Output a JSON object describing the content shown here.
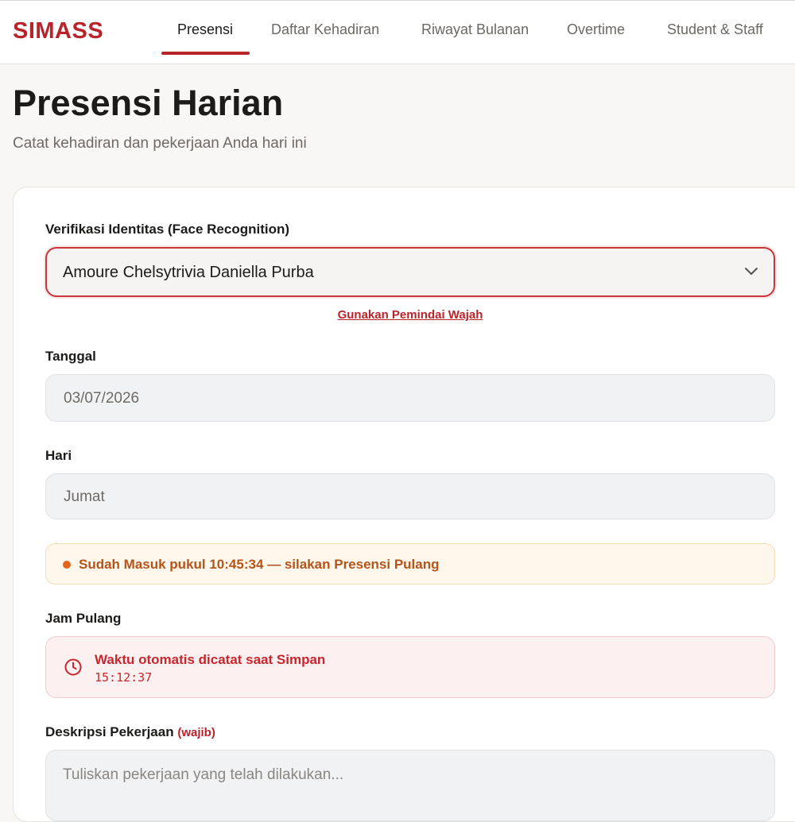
{
  "app": {
    "brand": "SIMASS"
  },
  "nav": {
    "tabs": [
      {
        "label": "Presensi",
        "active": true
      },
      {
        "label": "Daftar Kehadiran",
        "active": false
      },
      {
        "label": "Riwayat Bulanan",
        "active": false
      },
      {
        "label": "Overtime",
        "active": false
      },
      {
        "label": "Student & Staff",
        "active": false
      }
    ]
  },
  "page": {
    "title": "Presensi Harian",
    "subtitle": "Catat kehadiran dan pekerjaan Anda hari ini"
  },
  "form": {
    "identity": {
      "label": "Verifikasi Identitas (Face Recognition)",
      "selected": "Amoure Chelsytrivia Daniella Purba",
      "face_link": "Gunakan Pemindai Wajah"
    },
    "date": {
      "label": "Tanggal",
      "value": "03/07/2026"
    },
    "day": {
      "label": "Hari",
      "value": "Jumat"
    },
    "status": {
      "text": "Sudah Masuk pukul 10:45:34 — silakan Presensi Pulang"
    },
    "checkout": {
      "label": "Jam Pulang",
      "title": "Waktu otomatis dicatat saat Simpan",
      "time": "15:12:37"
    },
    "description": {
      "label": "Deskripsi Pekerjaan",
      "required": "(wajib)",
      "placeholder": "Tuliskan pekerjaan yang telah dilakukan..."
    }
  },
  "colors": {
    "brand": "#b9232a",
    "warning": "#b5541a",
    "danger": "#c8262d"
  },
  "icons": [
    "chevron-down-icon",
    "clock-icon",
    "status-dot-icon"
  ]
}
